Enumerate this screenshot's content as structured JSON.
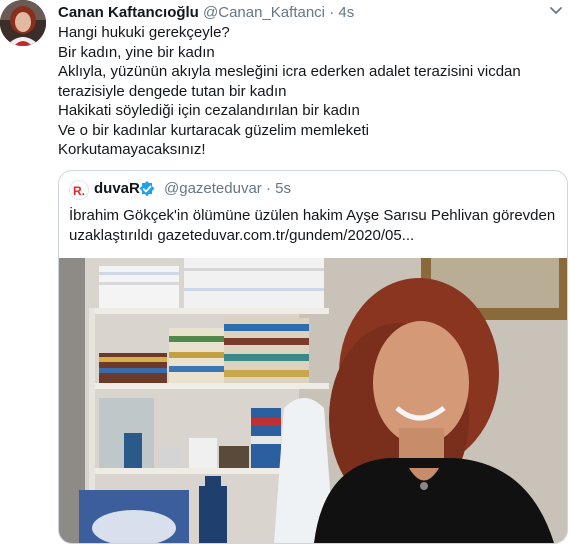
{
  "author": {
    "display_name": "Canan Kaftancıoğlu",
    "handle": "@Canan_Kaftanci",
    "separator": "·",
    "time": "4s",
    "avatar_icon": "profile-photo"
  },
  "tweet": {
    "lines": [
      "Hangi hukuki gerekçeyle?",
      "Bir kadın, yine bir kadın",
      "Aklıyla, yüzünün akıyla mesleğini icra ederken adalet terazisini vicdan",
      "terazisiyle dengede tutan bir kadın",
      "Hakikati söylediği için cezalandırılan bir kadın",
      "Ve o bir kadınlar kurtaracak güzelim memleketi",
      "Korkutamayacaksınız!"
    ]
  },
  "quoted": {
    "display_name": "duvaR",
    "handle": "@gazeteduvar",
    "separator": "·",
    "time": "5s",
    "logo_letter": "R.",
    "lines": [
      "İbrahim Gökçek'in ölümüne üzülen hakim Ayşe Sarısu Pehlivan görevden",
      "uzaklaştırıldı gazeteduvar.com.tr/gundem/2020/05..."
    ]
  },
  "colors": {
    "text": "#14171a",
    "muted": "#657786",
    "verified": "#1da1f2",
    "logo_red": "#e4262a",
    "border": "#ccd6dd"
  }
}
